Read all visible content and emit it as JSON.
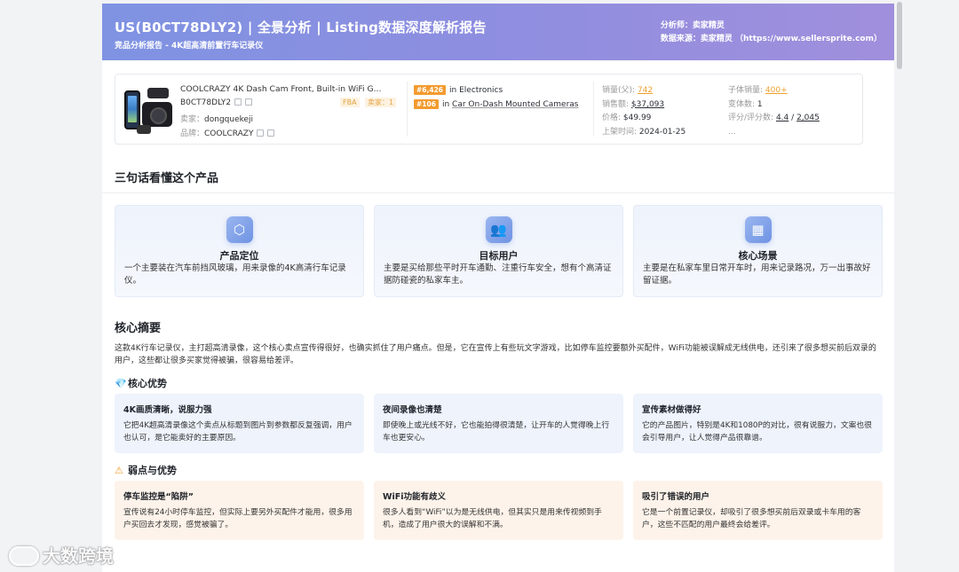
{
  "header": {
    "title": "US(B0CT78DLY2) | 全景分析 | Listing数据深度解析报告",
    "subtitle": "竞品分析报告 - 4K超高清前置行车记录仪",
    "analyst_label": "分析师：",
    "analyst": "卖家精灵",
    "source_label": "数据来源：",
    "source": "卖家精灵 （https://www.sellersprite.com）"
  },
  "product": {
    "name": "COOLCRAZY 4K Dash Cam Front, Built-in WiFi G...",
    "asin": "B0CT78DLY2",
    "fba": "FBA",
    "seller_count": "卖家：1",
    "seller_label": "卖家：",
    "seller": "dongquekeji",
    "brand_label": "品牌：",
    "brand": "COOLCRAZY",
    "rank1_badge": "#6,426",
    "rank1_in": "in",
    "rank1_cat": "Electronics",
    "rank2_badge": "#106",
    "rank2_in": "in",
    "rank2_cat": "Car On-Dash Mounted Cameras",
    "sales_parent_label": "销量(父):",
    "sales_parent": "742",
    "revenue_label": "销售额:",
    "revenue": "$37,093",
    "price_label": "价格:",
    "price": "$49.99",
    "listed_label": "上架时间:",
    "listed": "2024-01-25",
    "child_sales_label": "子体销量:",
    "child_sales": "400+",
    "variants_label": "变体数:",
    "variants": "1",
    "rating_label": "评分/评分数:",
    "rating": "4.4",
    "rating_sep": "/",
    "rating_count": "2,045",
    "more": "..."
  },
  "three_sentences": {
    "title": "三句话看懂这个产品",
    "items": [
      {
        "icon": "cube-icon",
        "glyph": "⬡",
        "title": "产品定位",
        "desc": "一个主要装在汽车前挡风玻璃，用来录像的4K高清行车记录仪。"
      },
      {
        "icon": "users-icon",
        "glyph": "👥",
        "title": "目标用户",
        "desc": "主要是买给那些平时开车通勤、注重行车安全，想有个高清证据防碰瓷的私家车主。"
      },
      {
        "icon": "grid-icon",
        "glyph": "▦",
        "title": "核心场景",
        "desc": "主要是在私家车里日常开车时，用来记录路况，万一出事故好留证据。"
      }
    ]
  },
  "core_summary": {
    "title": "核心摘要",
    "text": "这款4K行车记录仪，主打超高清录像，这个核心卖点宣传得很好，也确实抓住了用户痛点。但是，它在宣传上有些玩文字游戏，比如停车监控要额外买配件，WiFi功能被误解成无线供电，还引来了很多想买前后双录的用户，这些都让很多买家觉得被骗，很容易给差评。"
  },
  "advantages": {
    "title": "核心优势",
    "icon": "diamond-icon",
    "items": [
      {
        "title": "4K画质清晰，说服力强",
        "desc": "它把4K超高清录像这个卖点从标题到图片到参数都反复强调，用户也认可，是它能卖好的主要原因。"
      },
      {
        "title": "夜间录像也清楚",
        "desc": "即使晚上或光线不好，它也能拍得很清楚，让开车的人觉得晚上行车也更安心。"
      },
      {
        "title": "宣传素材做得好",
        "desc": "它的产品图片，特别是4K和1080P的对比，很有说服力，文案也很会引导用户，让人觉得产品很靠谱。"
      }
    ]
  },
  "weaknesses": {
    "title": "弱点与优势",
    "icon": "warning-icon",
    "items": [
      {
        "title": "停车监控是“陷阱”",
        "desc": "宣传说有24小时停车监控，但实际上要另外买配件才能用，很多用户买回去才发现，感觉被骗了。"
      },
      {
        "title": "WiFi功能有歧义",
        "desc": "很多人看到“WiFi”以为是无线供电，但其实只是用来传视频到手机，造成了用户很大的误解和不满。"
      },
      {
        "title": "吸引了错误的用户",
        "desc": "它是一个前置记录仪，却吸引了很多想买前后双录或卡车用的客户，这些不匹配的用户最终会给差评。"
      }
    ]
  },
  "watermark": "大数跨境",
  "colors": {
    "header_start": "#7f93e2",
    "header_end": "#a08fdc",
    "accent_orange": "#f39b2f",
    "adv_bg": "#eef3fc",
    "weak_bg": "#fdf3ea"
  }
}
